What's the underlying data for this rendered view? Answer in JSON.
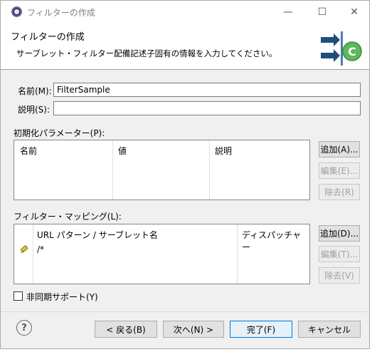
{
  "window": {
    "title": "フィルターの作成",
    "minimize": "—",
    "maximize": "☐",
    "close": "✕"
  },
  "header": {
    "title": "フィルターの作成",
    "description": "サーブレット・フィルター配備記述子固有の情報を入力してください。"
  },
  "form": {
    "name_label": "名前(M):",
    "name_value": "FilterSample",
    "description_label": "説明(S):",
    "description_value": ""
  },
  "init_params": {
    "label": "初期化パラメーター(P):",
    "columns": [
      "名前",
      "値",
      "説明"
    ],
    "rows": [],
    "add_button": "追加(A)...",
    "edit_button": "編集(E)...",
    "remove_button": "除去(R)"
  },
  "mappings": {
    "label": "フィルター・マッピング(L):",
    "columns": [
      "URL パターン / サーブレット名",
      "ディスパッチャー"
    ],
    "rows": [
      {
        "pattern": "/*",
        "dispatcher": ""
      }
    ],
    "add_button": "追加(D)...",
    "edit_button": "編集(T)...",
    "remove_button": "除去(V)"
  },
  "async": {
    "label": "非同期サポート(Y)",
    "checked": false
  },
  "footer": {
    "help": "?",
    "back": "< 戻る(B)",
    "next": "次へ(N) >",
    "finish": "完了(F)",
    "cancel": "キャンセル"
  },
  "colors": {
    "accent": "#0078d7",
    "disabled_text": "#a0a0a0",
    "wizard_green": "#5cb85c"
  }
}
